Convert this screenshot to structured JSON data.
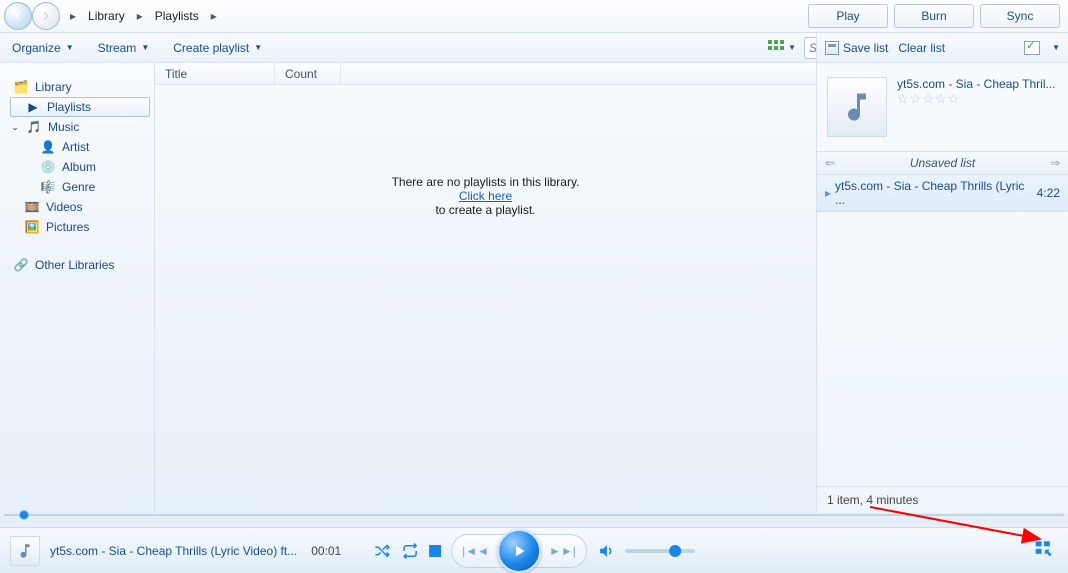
{
  "breadcrumb": {
    "root": "Library",
    "sub": "Playlists"
  },
  "tabs": {
    "play": "Play",
    "burn": "Burn",
    "sync": "Sync"
  },
  "toolbar": {
    "organize": "Organize",
    "stream": "Stream",
    "create_playlist": "Create playlist",
    "search_placeholder": "Search"
  },
  "rp_toolbar": {
    "save_list": "Save list",
    "clear_list": "Clear list"
  },
  "sidebar": {
    "library": "Library",
    "playlists": "Playlists",
    "music": "Music",
    "artist": "Artist",
    "album": "Album",
    "genre": "Genre",
    "videos": "Videos",
    "pictures": "Pictures",
    "other": "Other Libraries"
  },
  "columns": {
    "title": "Title",
    "count": "Count"
  },
  "empty": {
    "line1": "There are no playlists in this library.",
    "link": "Click here",
    "line2": "to create a playlist."
  },
  "now_playing": {
    "title": "yt5s.com - Sia - Cheap Thril...",
    "stars": "☆☆☆☆☆"
  },
  "list_header": "Unsaved list",
  "playlist_item": {
    "name": "yt5s.com - Sia - Cheap Thrills (Lyric ...",
    "dur": "4:22"
  },
  "status": "1 item, 4 minutes",
  "player": {
    "title": "yt5s.com - Sia - Cheap Thrills (Lyric Video) ft...",
    "time": "00:01"
  }
}
